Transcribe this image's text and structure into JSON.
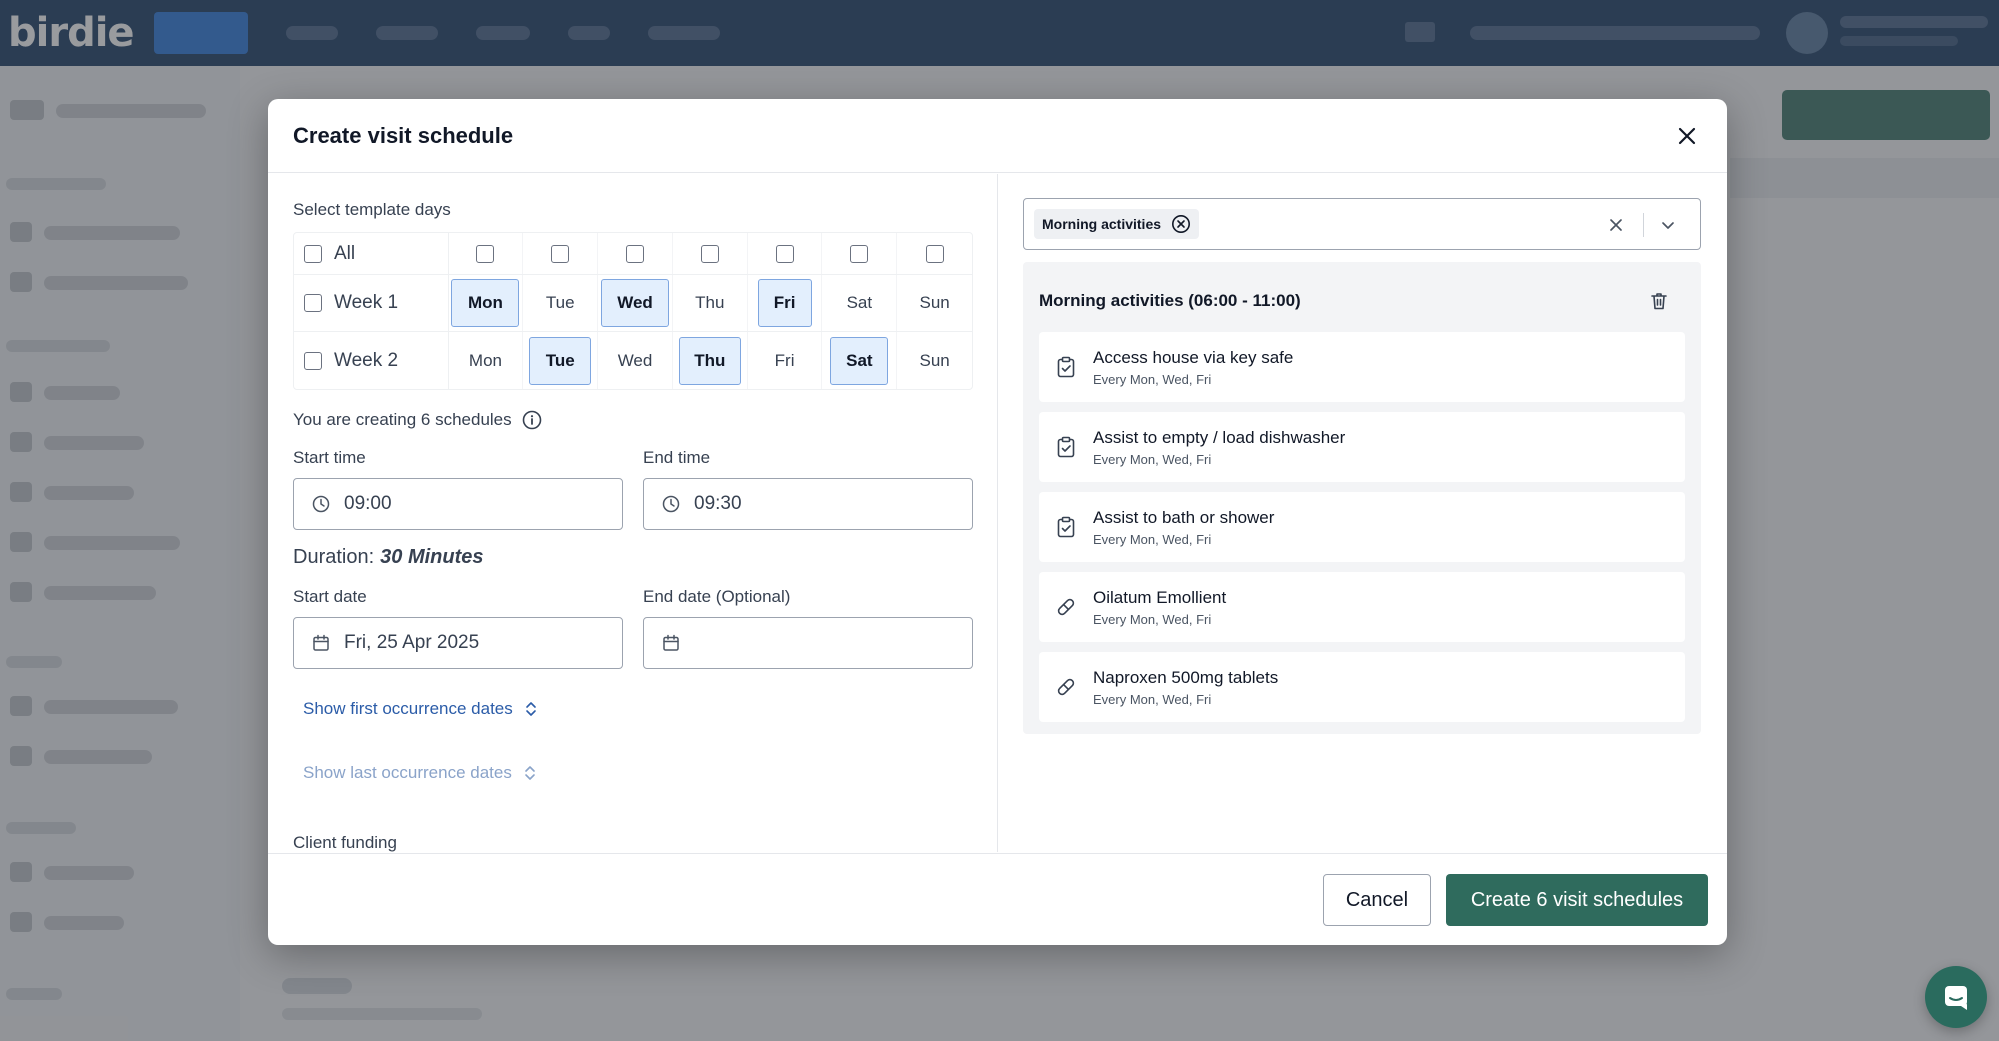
{
  "app": {
    "logo": "birdie"
  },
  "modal": {
    "title": "Create visit schedule",
    "template_days_label": "Select template days",
    "grid": {
      "all_label": "All",
      "weeks": [
        {
          "label": "Week 1",
          "days": [
            {
              "name": "Mon",
              "selected": true
            },
            {
              "name": "Tue",
              "selected": false
            },
            {
              "name": "Wed",
              "selected": true
            },
            {
              "name": "Thu",
              "selected": false
            },
            {
              "name": "Fri",
              "selected": true
            },
            {
              "name": "Sat",
              "selected": false
            },
            {
              "name": "Sun",
              "selected": false
            }
          ]
        },
        {
          "label": "Week 2",
          "days": [
            {
              "name": "Mon",
              "selected": false
            },
            {
              "name": "Tue",
              "selected": true
            },
            {
              "name": "Wed",
              "selected": false
            },
            {
              "name": "Thu",
              "selected": true
            },
            {
              "name": "Fri",
              "selected": false
            },
            {
              "name": "Sat",
              "selected": true
            },
            {
              "name": "Sun",
              "selected": false
            }
          ]
        }
      ]
    },
    "schedule_count_text": "You are creating 6 schedules",
    "start_time": {
      "label": "Start time",
      "value": "09:00"
    },
    "end_time": {
      "label": "End time",
      "value": "09:30"
    },
    "duration": {
      "label": "Duration:",
      "value": "30 Minutes"
    },
    "start_date": {
      "label": "Start date",
      "value": "Fri, 25 Apr 2025"
    },
    "end_date": {
      "label": "End date (Optional)",
      "value": ""
    },
    "show_first": "Show first occurrence dates",
    "show_last": "Show last occurrence dates",
    "client_funding": "Client funding",
    "template_select": {
      "chip": "Morning activities"
    },
    "panel": {
      "title": "Morning activities (06:00 - 11:00)",
      "tasks": [
        {
          "name": "Access house via key safe",
          "sub": "Every Mon, Wed, Fri",
          "icon": "clipboard-check-icon"
        },
        {
          "name": "Assist to empty / load dishwasher",
          "sub": "Every Mon, Wed, Fri",
          "icon": "clipboard-check-icon"
        },
        {
          "name": "Assist to bath or shower",
          "sub": "Every Mon, Wed, Fri",
          "icon": "clipboard-check-icon"
        },
        {
          "name": "Oilatum Emollient",
          "sub": "Every Mon, Wed, Fri",
          "icon": "pill-icon"
        },
        {
          "name": "Naproxen 500mg tablets",
          "sub": "Every Mon, Wed, Fri",
          "icon": "pill-icon"
        }
      ]
    },
    "footer": {
      "cancel": "Cancel",
      "create": "Create 6 visit schedules"
    }
  },
  "colors": {
    "primary": "#2f6b5d",
    "nav": "#0d2f5a",
    "selected_day": "#e3effd",
    "link": "#2b5ca8"
  }
}
